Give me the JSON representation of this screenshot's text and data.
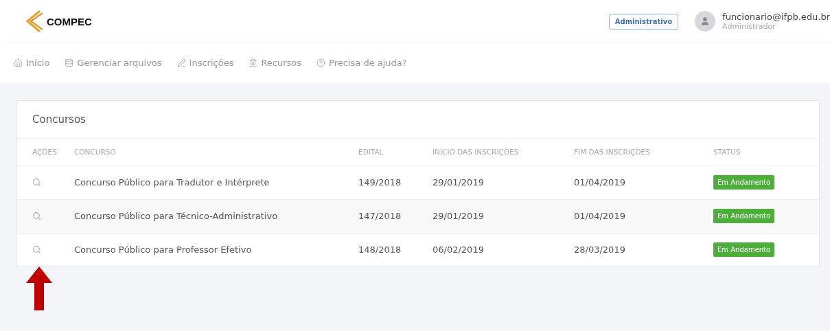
{
  "header": {
    "logo": "COMPEC",
    "role_button": "Administrativo",
    "user": {
      "email": "funcionario@ifpb.edu.br",
      "role": "Administrador"
    }
  },
  "nav": [
    {
      "label": "Início"
    },
    {
      "label": "Gerenciar arquivos"
    },
    {
      "label": "Inscrições"
    },
    {
      "label": "Recursos"
    },
    {
      "label": "Precisa de ajuda?"
    }
  ],
  "card": {
    "title": "Concursos",
    "table": {
      "columns": [
        "AÇÕES",
        "CONCURSO",
        "EDITAL",
        "INÍCIO DAS INSCRIÇÕES",
        "FIM DAS INSCRIÇÕES",
        "STATUS"
      ],
      "rows": [
        {
          "concurso": "Concurso Público para Tradutor e Intérprete",
          "edital": "149/2018",
          "inicio": "29/01/2019",
          "fim": "01/04/2019",
          "status": "Em Andamento",
          "color": "#4caf3a"
        },
        {
          "concurso": "Concurso Público para Técnico-Administrativo",
          "edital": "147/2018",
          "inicio": "29/01/2019",
          "fim": "01/04/2019",
          "status": "Em Andamento",
          "color": "#4caf3a"
        },
        {
          "concurso": "Concurso Público para Professor Efetivo",
          "edital": "148/2018",
          "inicio": "06/02/2019",
          "fim": "28/03/2019",
          "status": "Em Andamento",
          "color": "#4caf3a"
        }
      ]
    }
  }
}
